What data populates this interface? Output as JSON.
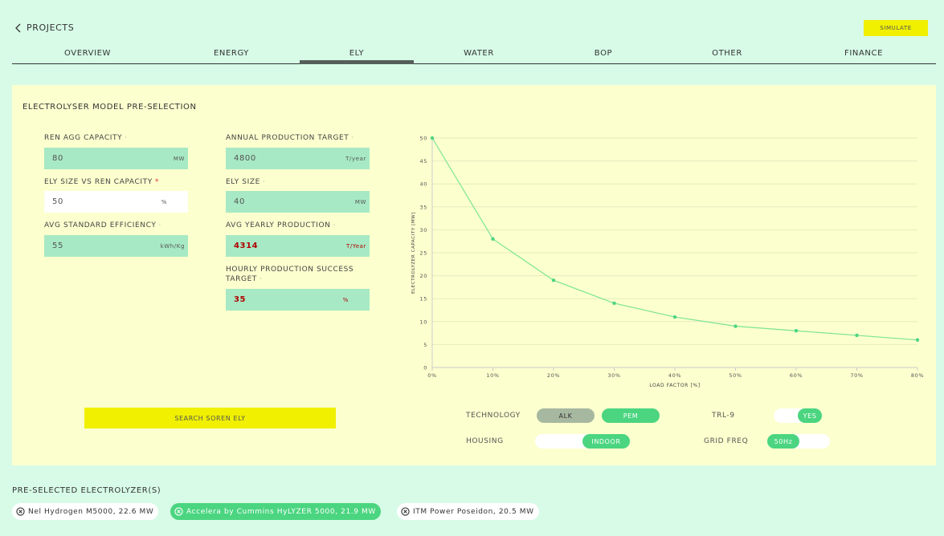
{
  "nav": {
    "back_label": "PROJECTS",
    "simulate_label": "SIMULATE"
  },
  "tabs": [
    {
      "label": "OVERVIEW",
      "active": false
    },
    {
      "label": "ENERGY",
      "active": false
    },
    {
      "label": "ELY",
      "active": true
    },
    {
      "label": "WATER",
      "active": false
    },
    {
      "label": "BOP",
      "active": false
    },
    {
      "label": "OTHER",
      "active": false
    },
    {
      "label": "FINANCE",
      "active": false
    }
  ],
  "panel": {
    "title": "ELECTROLYSER MODEL PRE-SELECTION",
    "fields": {
      "ren_agg_capacity": {
        "label": "REN AGG CAPACITY",
        "marker": "·",
        "value": "80",
        "unit": "MW"
      },
      "ely_size_vs_ren": {
        "label": "ELY SIZE VS REN CAPACITY",
        "marker": "*",
        "value": "50",
        "unit": "%"
      },
      "avg_std_efficiency": {
        "label": "AVG STANDARD EFFICIENCY",
        "marker": "·",
        "value": "55",
        "unit": "kWh/Kg"
      },
      "annual_target": {
        "label": "ANNUAL PRODUCTION TARGET",
        "marker": "·",
        "value": "4800",
        "unit": "T/year"
      },
      "ely_size": {
        "label": "ELY SIZE",
        "marker": "·",
        "value": "40",
        "unit": "MW"
      },
      "avg_yearly_production": {
        "label": "AVG YEARLY PRODUCTION",
        "marker": "·",
        "value": "4314",
        "unit": "T/Year"
      },
      "hourly_success": {
        "label_line1": "HOURLY PRODUCTION SUCCESS",
        "label_line2": "TARGET",
        "marker": "·",
        "value": "35",
        "unit": "%"
      }
    },
    "search_label": "SEARCH SOREN ELY",
    "toggles": {
      "technology": {
        "label": "TECHNOLOGY",
        "options": [
          "ALK",
          "PEM"
        ],
        "selected": "PEM"
      },
      "trl": {
        "label": "TRL-9",
        "value": "YES"
      },
      "housing": {
        "label": "HOUSING",
        "value": "INDOOR"
      },
      "grid_freq": {
        "label": "GRID FREQ",
        "value": "50Hz"
      }
    }
  },
  "chart_data": {
    "type": "line",
    "title": "",
    "xlabel": "LOAD FACTOR [%]",
    "ylabel": "ELECTROLYZER CAPACITY [MW]",
    "x": [
      0,
      10,
      20,
      30,
      40,
      50,
      60,
      70,
      80
    ],
    "x_tick_labels": [
      "0%",
      "10%",
      "20%",
      "30%",
      "40%",
      "50%",
      "60%",
      "70%",
      "80%"
    ],
    "y_ticks": [
      0,
      5,
      10,
      15,
      20,
      25,
      30,
      35,
      40,
      45,
      50
    ],
    "series": [
      {
        "values": [
          50,
          28,
          19,
          14,
          11,
          9,
          8,
          7,
          6
        ]
      }
    ],
    "xlim": [
      0,
      80
    ],
    "ylim": [
      0,
      50
    ],
    "grid": true,
    "line_color": "#7be495"
  },
  "preselected": {
    "title": "PRE-SELECTED ELECTROLYZER(S)",
    "items": [
      {
        "label": "Nel Hydrogen M5000, 22.6 MW",
        "selected": false
      },
      {
        "label": "Accelera by Cummins HyLYZER 5000, 21.9 MW",
        "selected": true
      },
      {
        "label": "ITM Power Poseidon, 20.5 MW",
        "selected": false
      }
    ]
  }
}
